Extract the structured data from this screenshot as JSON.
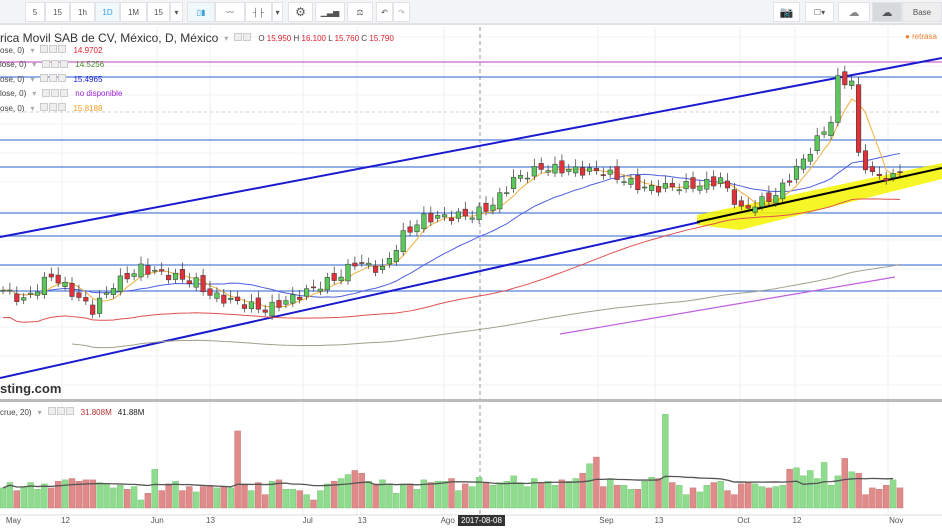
{
  "toolbar": {
    "intervals": [
      "5",
      "15",
      "1h",
      "1D",
      "1M",
      "15"
    ],
    "active_interval": "1D",
    "right": {
      "base_label": "Base"
    }
  },
  "header": {
    "title": "rica Movil SAB de CV, México, D, México",
    "ohlc": {
      "o_label": "O",
      "o": "15.950",
      "h_label": "H",
      "h": "16.100",
      "l_label": "L",
      "l": "15.760",
      "c_label": "C",
      "c": "15.790"
    },
    "status": "retrasa"
  },
  "indicators": [
    {
      "label": "ose, 0)",
      "value": "14.9702",
      "color": "#e0202a"
    },
    {
      "label": "lose, 0)",
      "value": "14.5256",
      "color": "#4b8a2a"
    },
    {
      "label": "ose, 0)",
      "value": "15.4965",
      "color": "#1a1ad0"
    },
    {
      "label": "lose, 0)",
      "value": "no disponible",
      "color": "#9b20d0"
    },
    {
      "label": "ose, 0)",
      "value": "15.8188",
      "color": "#f0a020"
    }
  ],
  "watermark": "sting.com",
  "volume": {
    "label": "crue, 20)",
    "value1": "31.808M",
    "value2": "41.88M"
  },
  "xaxis": [
    {
      "label": "May",
      "day": 1
    },
    {
      "label": "12",
      "day": 9
    },
    {
      "label": "Jun",
      "day": 22
    },
    {
      "label": "13",
      "day": 30
    },
    {
      "label": "Jul",
      "day": 44
    },
    {
      "label": "13",
      "day": 52
    },
    {
      "label": "Ago",
      "day": 64
    },
    {
      "label": "Sep",
      "day": 87
    },
    {
      "label": "13",
      "day": 95
    },
    {
      "label": "Oct",
      "day": 107
    },
    {
      "label": "12",
      "day": 115
    },
    {
      "label": "Nov",
      "day": 129
    }
  ],
  "crosshair_date": "2017-08-08",
  "colors": {
    "up": "#5cc85c",
    "down": "#e0323a",
    "vol_up": "#8fdc8f",
    "vol_down": "#e08a8a"
  },
  "chart_data": {
    "type": "candlestick",
    "price_path": [
      [
        0,
        13.38
      ],
      [
        3,
        13.25
      ],
      [
        7,
        13.57
      ],
      [
        13,
        13.13
      ],
      [
        16,
        13.45
      ],
      [
        20,
        13.66
      ],
      [
        28,
        13.48
      ],
      [
        30,
        13.32
      ],
      [
        38,
        13.13
      ],
      [
        43,
        13.32
      ],
      [
        49,
        13.57
      ],
      [
        51,
        13.74
      ],
      [
        55,
        13.64
      ],
      [
        58,
        14.08
      ],
      [
        61,
        14.3
      ],
      [
        68,
        14.34
      ],
      [
        71,
        14.47
      ],
      [
        74,
        14.79
      ],
      [
        78,
        14.94
      ],
      [
        87,
        14.89
      ],
      [
        93,
        14.68
      ],
      [
        101,
        14.72
      ],
      [
        104,
        14.79
      ],
      [
        107,
        14.4
      ],
      [
        112,
        14.59
      ],
      [
        116,
        15.04
      ],
      [
        120,
        15.55
      ],
      [
        121,
        16.06
      ],
      [
        123,
        16.04
      ],
      [
        124,
        15.1
      ],
      [
        126,
        14.85
      ],
      [
        129,
        14.81
      ],
      [
        130,
        14.91
      ]
    ],
    "volumes_M": [
      30,
      38,
      26,
      32,
      38,
      28,
      36,
      30,
      40,
      42,
      44,
      40,
      42,
      42,
      38,
      36,
      30,
      34,
      28,
      32,
      12,
      22,
      58,
      26,
      36,
      40,
      26,
      32,
      24,
      32,
      34,
      30,
      32,
      30,
      115,
      34,
      26,
      38,
      20,
      40,
      42,
      28,
      28,
      26,
      20,
      12,
      26,
      36,
      40,
      44,
      50,
      56,
      52,
      40,
      36,
      42,
      36,
      22,
      34,
      36,
      28,
      42,
      38,
      40,
      40,
      44,
      26,
      36,
      32,
      46,
      38,
      34,
      38,
      40,
      48,
      38,
      32,
      44,
      38,
      40,
      34,
      42,
      40,
      44,
      52,
      66,
      76,
      32,
      44,
      34,
      34,
      28,
      28,
      40,
      46,
      44,
      140,
      38,
      34,
      20,
      30,
      24,
      34,
      38,
      40,
      26,
      20,
      36,
      38,
      36,
      32,
      30,
      32,
      34,
      58,
      60,
      48,
      56,
      44,
      68,
      34,
      48,
      74,
      54,
      52,
      20,
      30,
      28,
      34,
      42
    ]
  }
}
